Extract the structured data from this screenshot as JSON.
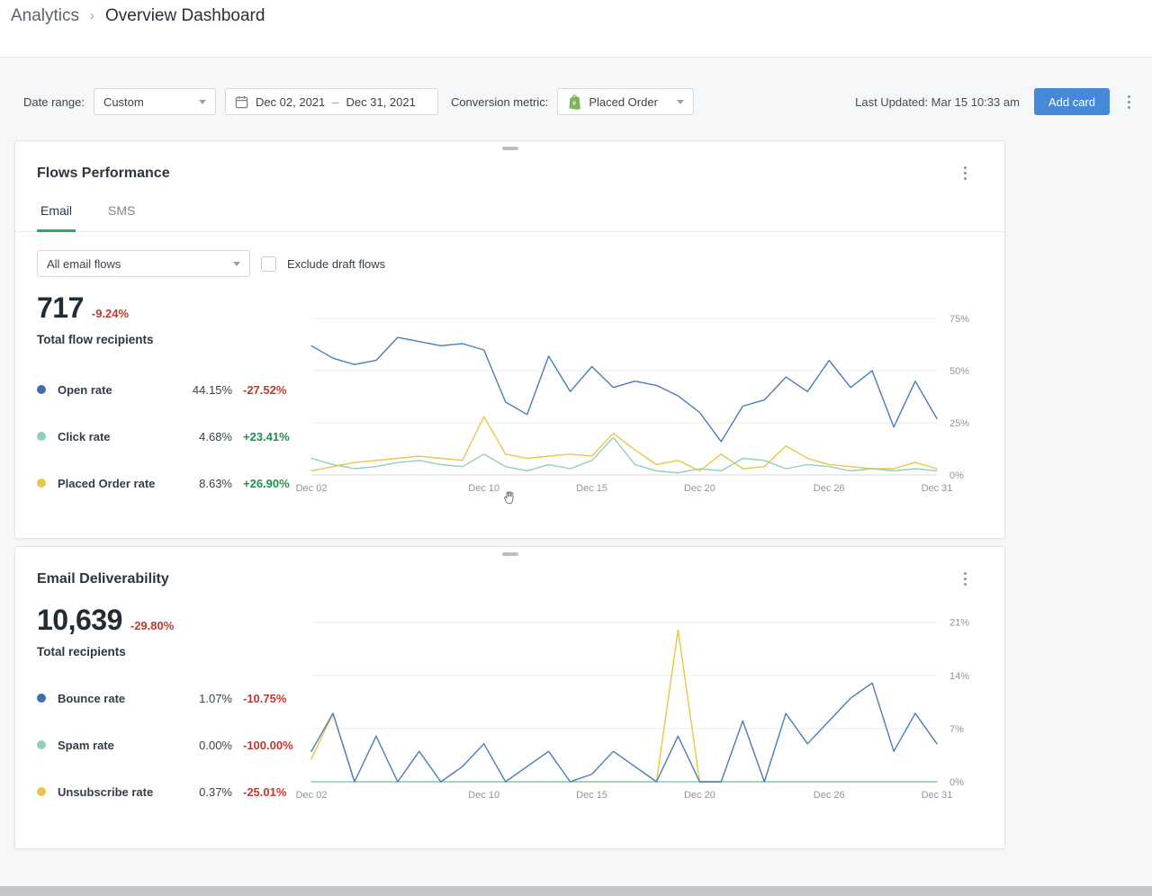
{
  "breadcrumb": {
    "section": "Analytics",
    "separator": "›",
    "page": "Overview Dashboard"
  },
  "filter_bar": {
    "date_range_label": "Date range:",
    "date_range_value": "Custom",
    "date_start": "Dec 02, 2021",
    "date_separator": "–",
    "date_end": "Dec 31, 2021",
    "conversion_metric_label": "Conversion metric:",
    "conversion_metric_value": "Placed Order",
    "last_updated": "Last Updated: Mar 15 10:33 am",
    "add_card_label": "Add card"
  },
  "colors": {
    "accent_blue": "#4689d8",
    "tab_active_green": "#17b26a",
    "negative_red": "#bf3a2e",
    "positive_green": "#18944f",
    "line_blue": "#4a7db5",
    "line_teal": "#8ed1ba",
    "line_yellow": "#e8c64b"
  },
  "cards": {
    "flows": {
      "title": "Flows Performance",
      "tabs": [
        {
          "label": "Email"
        },
        {
          "label": "SMS"
        }
      ],
      "flow_filter_value": "All email flows",
      "exclude_label": "Exclude draft flows",
      "total_value": "717",
      "total_delta": "-9.24%",
      "total_delta_dir": "down",
      "total_label": "Total flow recipients",
      "legend": [
        {
          "label": "Open rate",
          "value": "44.15%",
          "delta": "-27.52%",
          "delta_dir": "down",
          "color": "#3d6fae"
        },
        {
          "label": "Click rate",
          "value": "4.68%",
          "delta": "+23.41%",
          "delta_dir": "up",
          "color": "#8ed1ba"
        },
        {
          "label": "Placed Order rate",
          "value": "8.63%",
          "delta": "+26.90%",
          "delta_dir": "up",
          "color": "#e8c64b"
        }
      ]
    },
    "deliverability": {
      "title": "Email Deliverability",
      "total_value": "10,639",
      "total_delta": "-29.80%",
      "total_delta_dir": "down",
      "total_label": "Total recipients",
      "legend": [
        {
          "label": "Bounce rate",
          "value": "1.07%",
          "delta": "-10.75%",
          "delta_dir": "down",
          "color": "#3d6fae"
        },
        {
          "label": "Spam rate",
          "value": "0.00%",
          "delta": "-100.00%",
          "delta_dir": "down",
          "color": "#8ed1ba"
        },
        {
          "label": "Unsubscribe rate",
          "value": "0.37%",
          "delta": "-25.01%",
          "delta_dir": "down",
          "color": "#e8c64b"
        }
      ]
    }
  },
  "chart_data": [
    {
      "id": "flows-chart",
      "type": "line",
      "title": "Flows Performance — Email rates by day",
      "x_tick_labels": [
        "Dec 02",
        "Dec 10",
        "Dec 15",
        "Dec 20",
        "Dec 26",
        "Dec 31"
      ],
      "x_tick_indices": [
        0,
        8,
        13,
        18,
        24,
        29
      ],
      "ylim": [
        0,
        82
      ],
      "yticks": [
        {
          "value": 0,
          "label": "0%"
        },
        {
          "value": 25,
          "label": "25%"
        },
        {
          "value": 50,
          "label": "50%"
        },
        {
          "value": 75,
          "label": "75%"
        }
      ],
      "legend_position": "left",
      "grid": true,
      "series": [
        {
          "name": "Open rate",
          "color": "#4a7db5",
          "values": [
            62,
            56,
            53,
            55,
            66,
            64,
            62,
            63,
            60,
            35,
            29,
            57,
            40,
            52,
            42,
            45,
            43,
            38,
            30,
            16,
            33,
            36,
            47,
            40,
            55,
            42,
            50,
            23,
            45,
            27
          ]
        },
        {
          "name": "Click rate",
          "color": "#8ed1ba",
          "values": [
            8,
            5,
            3,
            4,
            6,
            7,
            5,
            4,
            10,
            4,
            2,
            5,
            3,
            7,
            18,
            5,
            2,
            1,
            3,
            2,
            8,
            7,
            3,
            5,
            4,
            2,
            3,
            2,
            3,
            2
          ]
        },
        {
          "name": "Placed Order rate",
          "color": "#e8c64b",
          "values": [
            2,
            4,
            6,
            7,
            8,
            9,
            8,
            7,
            28,
            10,
            8,
            9,
            10,
            9,
            20,
            12,
            5,
            7,
            2,
            10,
            3,
            4,
            14,
            8,
            5,
            4,
            3,
            3,
            6,
            3
          ]
        }
      ]
    },
    {
      "id": "deliverability-chart",
      "type": "line",
      "title": "Email Deliverability rates by day",
      "x_tick_labels": [
        "Dec 02",
        "Dec 10",
        "Dec 15",
        "Dec 20",
        "Dec 26",
        "Dec 31"
      ],
      "x_tick_indices": [
        0,
        8,
        13,
        18,
        24,
        29
      ],
      "ylim": [
        0,
        22.5
      ],
      "yticks": [
        {
          "value": 0,
          "label": "0%"
        },
        {
          "value": 7,
          "label": "7%"
        },
        {
          "value": 14,
          "label": "14%"
        },
        {
          "value": 21,
          "label": "21%"
        }
      ],
      "legend_position": "left",
      "grid": true,
      "series": [
        {
          "name": "Bounce rate",
          "color": "#4a7db5",
          "values": [
            4,
            9,
            0,
            6,
            0,
            4,
            0,
            2,
            5,
            0,
            2,
            4,
            0,
            1,
            4,
            2,
            0,
            6,
            0,
            0,
            8,
            0,
            9,
            5,
            8,
            11,
            13,
            4,
            9,
            5
          ]
        },
        {
          "name": "Spam rate",
          "color": "#8ed1ba",
          "values": [
            0,
            0,
            0,
            0,
            0,
            0,
            0,
            0,
            0,
            0,
            0,
            0,
            0,
            0,
            0,
            0,
            0,
            0,
            0,
            0,
            0,
            0,
            0,
            0,
            0,
            0,
            0,
            0,
            0,
            0
          ]
        },
        {
          "name": "Unsubscribe rate",
          "color": "#e8c64b",
          "values": [
            3,
            9,
            0,
            0,
            0,
            0,
            0,
            0,
            0,
            0,
            0,
            0,
            0,
            0,
            0,
            0,
            0,
            20,
            0,
            0,
            0,
            0,
            0,
            0,
            0,
            0,
            0,
            0,
            0,
            0
          ]
        }
      ]
    }
  ]
}
